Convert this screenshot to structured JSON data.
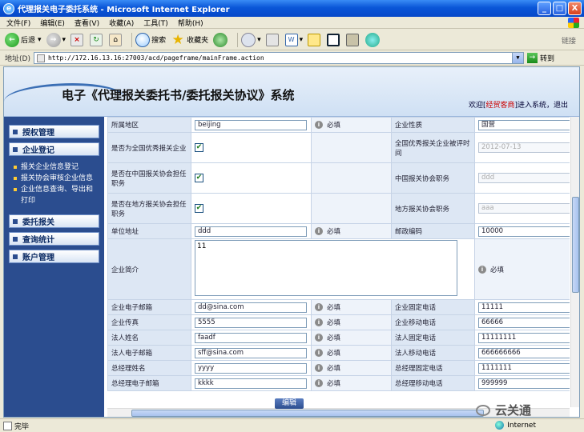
{
  "window": {
    "title": "代理报关电子委托系统 - Microsoft Internet Explorer",
    "buttons": {
      "minimize": "_",
      "maximize": "□",
      "close": "X"
    }
  },
  "menu": [
    "文件(F)",
    "编辑(E)",
    "查看(V)",
    "收藏(A)",
    "工具(T)",
    "帮助(H)"
  ],
  "toolbar": {
    "back_label": "后退",
    "search_label": "搜索",
    "favorites_label": "收藏夹",
    "links_label": "链接"
  },
  "address": {
    "label": "地址(D)",
    "url": "http://172.16.13.16:27003/acd/pageframe/mainFrame.action",
    "go_label": "转到"
  },
  "banner": {
    "title": "电子《代理报关委托书/委托报关协议》系统",
    "welcome_prefix": "欢迎[",
    "user": "经贸客商",
    "welcome_suffix": "]进入系统，",
    "logout": "退出"
  },
  "sidebar": {
    "items": [
      {
        "label": "授权管理"
      },
      {
        "label": "企业登记"
      },
      {
        "label": "委托报关"
      },
      {
        "label": "查询统计"
      },
      {
        "label": "账户管理"
      }
    ],
    "sub_items": [
      {
        "label": "报关企业信息登记"
      },
      {
        "label": "报关协会审核企业信息"
      },
      {
        "label": "企业信息查询、导出和打印"
      }
    ]
  },
  "form": {
    "required": "必填",
    "rows": [
      {
        "l1": "所属地区",
        "v1": "beijing",
        "l2": "企业性质",
        "v2": "国营"
      },
      {
        "l1": "是否为全国优秀报关企业",
        "l2": "全国优秀报关企业被评时间",
        "v2": "2012-07-13"
      },
      {
        "l1": "是否在中国报关协会担任职务",
        "l2": "中国报关协会职务",
        "v2": "ddd"
      },
      {
        "l1": "是否在地方报关协会担任职务",
        "l2": "地方报关协会职务",
        "v2": "aaa"
      },
      {
        "l1": "单位地址",
        "v1": "ddd",
        "l2": "邮政编码",
        "v2": "10000"
      },
      {
        "l1": "企业简介",
        "v1": "11"
      },
      {
        "l1": "企业电子邮箱",
        "v1": "dd@sina.com",
        "l2": "企业固定电话",
        "v2": "11111"
      },
      {
        "l1": "企业传真",
        "v1": "5555",
        "l2": "企业移动电话",
        "v2": "66666"
      },
      {
        "l1": "法人姓名",
        "v1": "faadf",
        "l2": "法人固定电话",
        "v2": "11111111"
      },
      {
        "l1": "法人电子邮箱",
        "v1": "sff@sina.com",
        "l2": "法人移动电话",
        "v2": "666666666"
      },
      {
        "l1": "总经理姓名",
        "v1": "yyyy",
        "l2": "总经理固定电话",
        "v2": "1111111"
      },
      {
        "l1": "总经理电子邮箱",
        "v1": "kkkk",
        "l2": "总经理移动电话",
        "v2": "999999"
      }
    ],
    "edit_button": "编辑"
  },
  "watermark": "云关通",
  "status": {
    "text": "完毕",
    "zone": "Internet"
  }
}
